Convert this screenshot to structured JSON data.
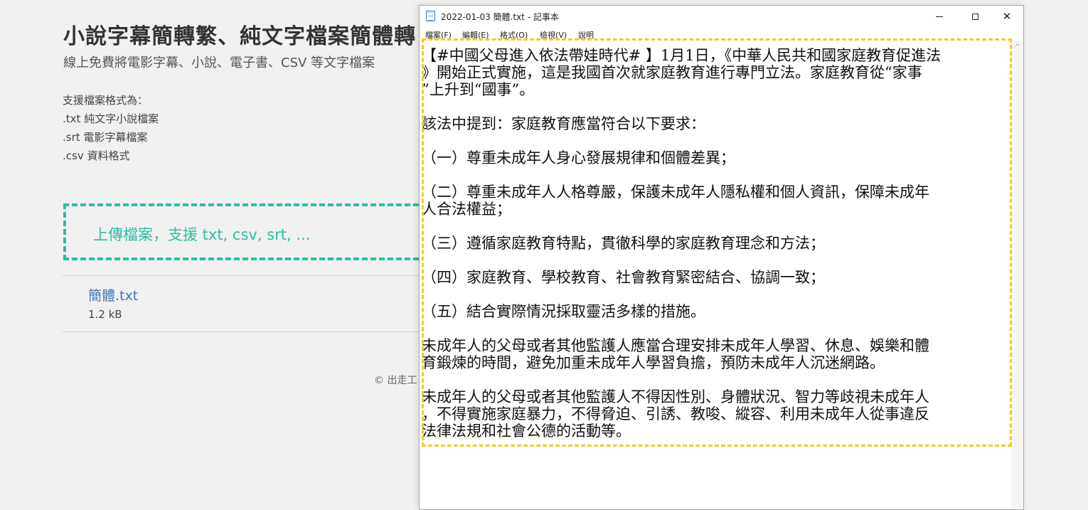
{
  "page": {
    "title": "小說字幕簡轉繁、純文字檔案簡體轉",
    "subtitle": "線上免費將電影字幕、小說、電子書、CSV 等文字檔案",
    "formats_heading": "支援檔案格式為：",
    "formats": [
      ".txt 純文字小說檔案",
      ".srt 電影字幕檔案",
      ".csv 資料格式"
    ],
    "upload_prompt": "上傳檔案，支援 txt, csv, srt, ...",
    "file": {
      "name": "簡體.txt",
      "size": "1.2 kB"
    },
    "footer": "© 出走工"
  },
  "notepad": {
    "title": "2022-01-03 簡體.txt - 記事本",
    "menu": [
      "檔案(F)",
      "編輯(E)",
      "格式(O)",
      "檢視(V)",
      "說明"
    ],
    "lines": [
      "【#中國父母進入依法帶娃時代#  】1月1日，《中華人民共和國家庭教育促進法",
      "》開始正式實施，這是我國首次就家庭教育進行專門立法。家庭教育從“家事",
      "”上升到“國事”。",
      "該法中提到：家庭教育應當符合以下要求：",
      "（一）尊重未成年人身心發展規律和個體差異；",
      "（二）尊重未成年人人格尊嚴，保護未成年人隱私權和個人資訊，保障未成年",
      "人合法權益；",
      "（三）遵循家庭教育特點，貫徹科學的家庭教育理念和方法；",
      "（四）家庭教育、學校教育、社會教育緊密結合、協調一致；",
      "（五）結合實際情況採取靈活多樣的措施。",
      "未成年人的父母或者其他監護人應當合理安排未成年人學習、休息、娛樂和體",
      "育鍛煉的時間，避免加重未成年人學習負擔，預防未成年人沉迷網路。",
      "未成年人的父母或者其他監護人不得因性別、身體狀況、智力等歧視未成年人",
      "，不得實施家庭暴力，不得脅迫、引誘、教唆、縱容、利用未成年人從事違反",
      "法律法規和社會公德的活動等。"
    ]
  },
  "colors": {
    "upload_accent": "#2bbfa4",
    "highlight": "#f3ce1f",
    "link": "#3c78b4"
  },
  "icons": [
    "notepad-icon",
    "minimize-icon",
    "maximize-icon",
    "close-icon",
    "scroll-up-icon"
  ]
}
